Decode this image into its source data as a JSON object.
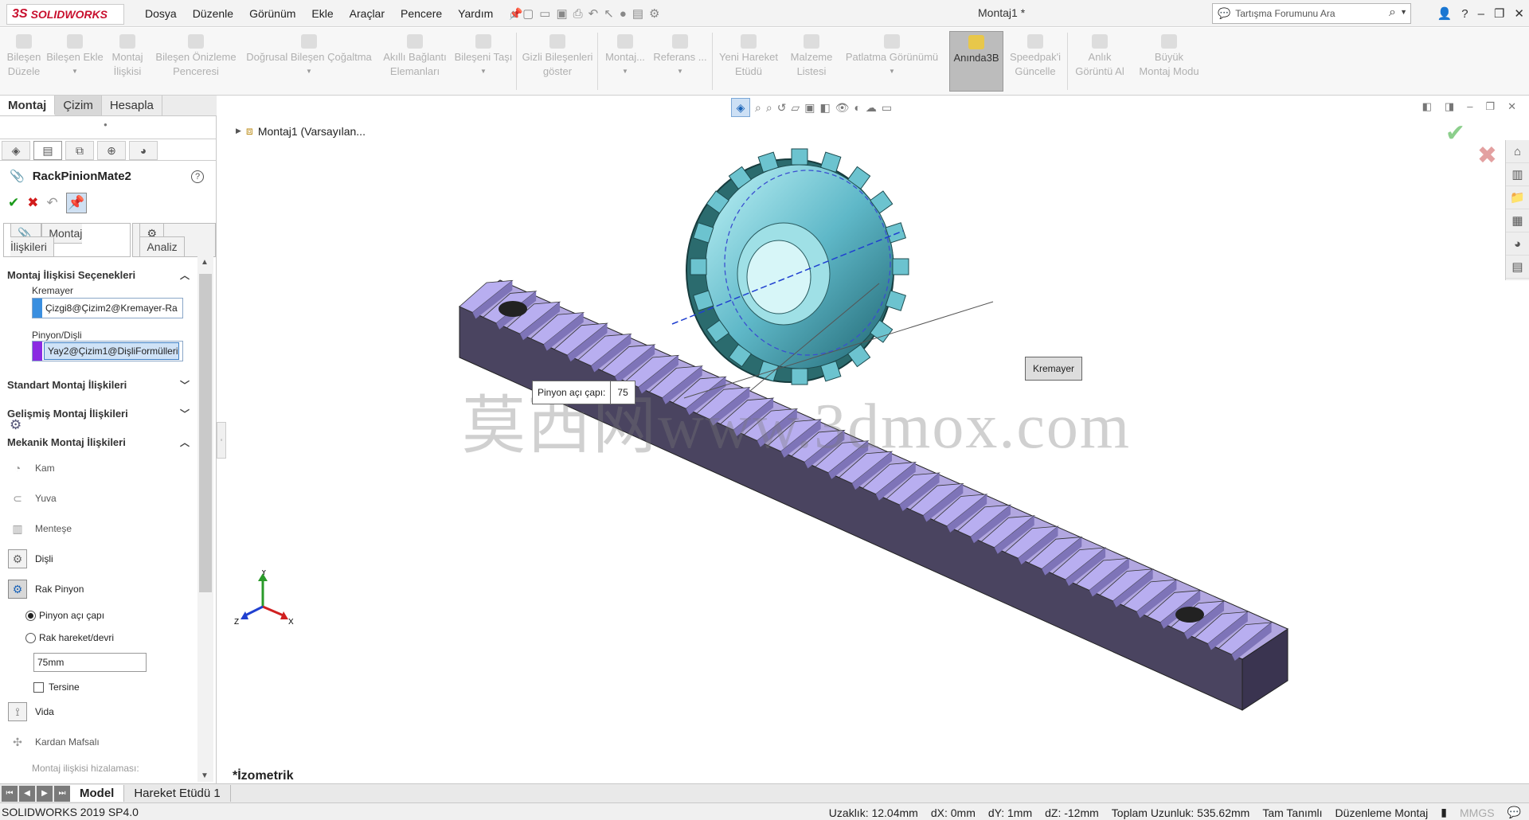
{
  "app": {
    "logo": "SOLIDWORKS",
    "logo_mark": "3S",
    "doc_title": "Montaj1 *"
  },
  "menu": [
    "Dosya",
    "Düzenle",
    "Görünüm",
    "Ekle",
    "Araçlar",
    "Pencere",
    "Yardım"
  ],
  "search": {
    "placeholder": "Tartışma Forumunu Ara"
  },
  "commands": [
    {
      "label": "Bileşen\nDüzele"
    },
    {
      "label": "Bileşen Ekle"
    },
    {
      "label": "Montaj\nİlişkisi"
    },
    {
      "label": "Bileşen Önizleme\nPenceresi"
    },
    {
      "label": "Doğrusal Bileşen Çoğaltma"
    },
    {
      "label": "Akıllı Bağlantı\nElemanları"
    },
    {
      "label": "Bileşeni Taşı"
    },
    {
      "label": "Gizli Bileşenleri\ngöster"
    },
    {
      "label": "Montaj..."
    },
    {
      "label": "Referans ..."
    },
    {
      "label": "Yeni Hareket\nEtüdü"
    },
    {
      "label": "Malzeme\nListesi"
    },
    {
      "label": "Patlatma Görünümü"
    },
    {
      "label": "Anında3B"
    },
    {
      "label": "Speedpak'i\nGüncelle"
    },
    {
      "label": "Anlık\nGörüntü Al"
    },
    {
      "label": "Büyük\nMontaj Modu"
    }
  ],
  "tabs": [
    "Montaj",
    "Çizim",
    "Hesapla"
  ],
  "pm": {
    "title": "RackPinionMate2",
    "subtabs": [
      "Montaj İlişkileri",
      "Analiz"
    ],
    "sections": {
      "options": "Montaj İlişkisi Seçenekleri",
      "standard": "Standart Montaj İlişkileri",
      "advanced": "Gelişmiş Montaj İlişkileri",
      "mechanical": "Mekanik Montaj İlişkileri"
    },
    "rack_label": "Kremayer",
    "rack_value": "Çizgi8@Çizim2@Kremayer-Ra",
    "rack_color": "#3a8fe0",
    "pinion_label": "Pinyon/Dişli",
    "pinion_value": "Yay2@Çizim1@DişliFormülleri",
    "pinion_color": "#8a2be2",
    "mech_items": [
      "Kam",
      "Yuva",
      "Menteşe",
      "Dişli",
      "Rak Pinyon"
    ],
    "radio1": "Pinyon açı çapı",
    "radio2": "Rak hareket/devri",
    "value": "75mm",
    "reverse": "Tersine",
    "more_items": [
      "Vida",
      "Kardan Mafsalı"
    ],
    "hint": "Montaj ilişkisi hizalaması:"
  },
  "viewport": {
    "tree_label": "Montaj1  (Varsayılan...",
    "callout_label": "Pinyon açı çapı:",
    "callout_value": "75",
    "rack_callout": "Kremayer",
    "watermark": "莫西网www.3dmox.com",
    "view_name": "*İzometrik",
    "triad_z": "Z",
    "triad_x": "X",
    "triad_y": "Y"
  },
  "bottom_tabs": [
    "Model",
    "Hareket Etüdü 1"
  ],
  "status": {
    "version": "SOLIDWORKS 2019 SP4.0",
    "distance": "Uzaklık: 12.04mm",
    "dx": "dX: 0mm",
    "dy": "dY: 1mm",
    "dz": "dZ: -12mm",
    "total": "Toplam Uzunluk: 535.62mm",
    "state": "Tam Tanımlı",
    "mode": "Düzenleme Montaj",
    "units": "MMGS"
  }
}
